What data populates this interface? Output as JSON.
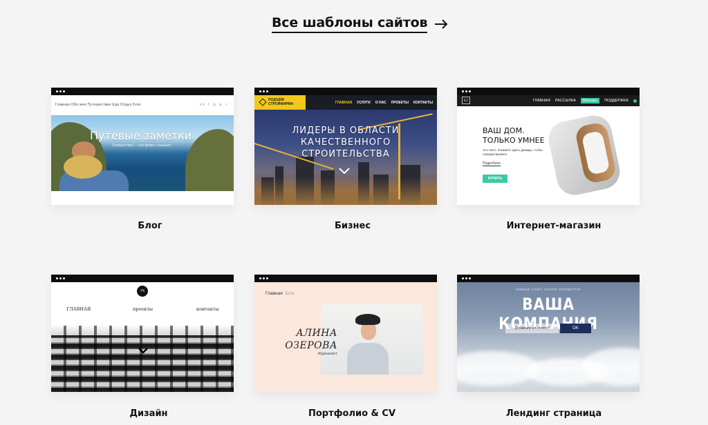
{
  "all_templates": {
    "label": "Все шаблоны сайтов"
  },
  "cards": [
    {
      "caption": "Блог",
      "nav": "Главная   Обо мне   Путешествия   Еда   Отдых   Блог",
      "social": "vk f ◎ p ✓",
      "title": "Путевые заметки",
      "subtitle": "Путешествия — это флирт с жизнью"
    },
    {
      "caption": "Бизнес",
      "logo": "ПОДЪЁМ СТРОЙФИРМА",
      "nav": [
        "ГЛАВНАЯ",
        "УСЛУГИ",
        "О НАС",
        "ПРОЕКТЫ",
        "КОНТАКТЫ"
      ],
      "title_line1": "ЛИДЕРЫ В ОБЛАСТИ",
      "title_line2": "КАЧЕСТВЕННОГО",
      "title_line3": "СТРОИТЕЛЬСТВА"
    },
    {
      "caption": "Интернет-магазин",
      "logo": "EZ",
      "nav": [
        "ГЛАВНАЯ",
        "РАССЫЛКА",
        "Магазин",
        "ПОДДЕРЖКА"
      ],
      "heading_line1": "ВАШ ДОМ.",
      "heading_line2": "ТОЛЬКО УМНЕЕ",
      "text": "Это текст. Кликните здесь дважды, чтобы отредактировать.",
      "more": "Подробнее",
      "buy": "КУПИТЬ"
    },
    {
      "caption": "Дизайн",
      "logo": "УХ",
      "nav": [
        "ГЛАВНАЯ",
        "проекты",
        "контакты"
      ]
    },
    {
      "caption": "Портфолио & CV",
      "nav_main": "Главная",
      "nav_blog": "Блог",
      "name_line1": "АЛИНА",
      "name_line2": "ОЗЕРОВА",
      "role": "Журналист"
    },
    {
      "caption": "Лендинг страница",
      "small": "НОВЫЙ САЙТ СКОРО ПОЯВИТСЯ",
      "title": "ВАША КОМПАНИЯ",
      "field_placeholder": "Добавьте эл. почту*",
      "ok": "OK"
    }
  ],
  "colors": {
    "accent_green": "#3bc8a8",
    "accent_yellow": "#f2c81a",
    "navy": "#1f2c5e"
  }
}
